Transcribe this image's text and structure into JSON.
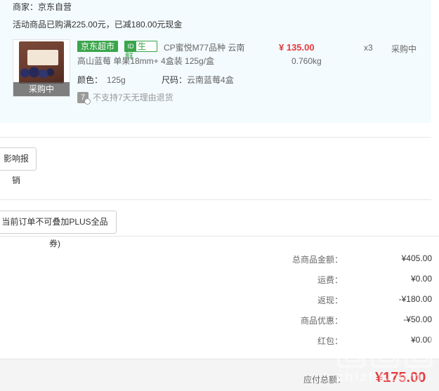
{
  "order": {
    "merchant": "商家：京东自营",
    "promo": "活动商品已购满225.00元，已减180.00元现金",
    "item": {
      "thumb_status": "采购中",
      "tag_jd": "京东超市",
      "tag_fresh": "生鲜",
      "tag_fresh_icon": "ID",
      "name_line1": "CP蜜悦M77品种 云南",
      "name_line2": "高山蓝莓 单果18mm+ 4盒装 125g/盒",
      "color_key": "颜色：",
      "color_val": "125g",
      "size_key": "尺码：",
      "size_val": "云南蓝莓4盒",
      "return_icon": "7",
      "return_policy": "不支持7天无理由退货",
      "price": "¥ 135.00",
      "weight": "0.760kg",
      "qty": "x3",
      "stock": "采购中"
    }
  },
  "buttons": {
    "invoice": "影响报销",
    "coupon": "当前订单不可叠加PLUS全品券)"
  },
  "summary": {
    "rows": [
      {
        "label": "总商品金额：",
        "value": "¥405.00"
      },
      {
        "label": "运费：",
        "value": "¥0.00"
      },
      {
        "label": "返现：",
        "value": "-¥180.00"
      },
      {
        "label": "商品优惠：",
        "value": "-¥50.00"
      },
      {
        "label": "红包：",
        "value": "¥0.00"
      }
    ],
    "pay_label": "应付总额：",
    "pay_value": "¥175.00"
  },
  "watermark": {
    "text": "zhizhi.com"
  },
  "colors": {
    "accent_red": "#e4393c",
    "jd_green": "#3aa54a",
    "order_bg": "#f3fbfe"
  }
}
